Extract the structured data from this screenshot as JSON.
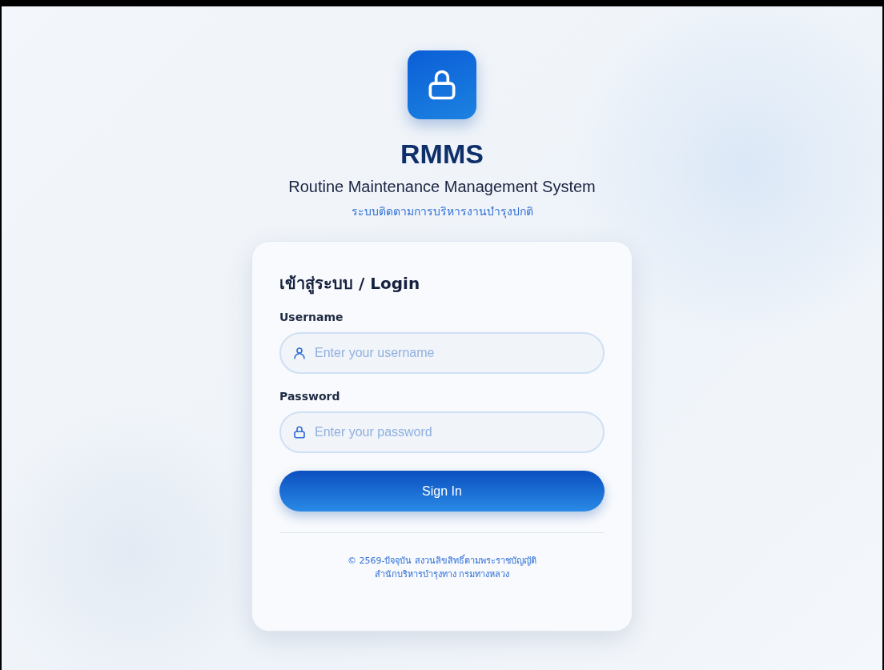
{
  "app": {
    "name": "RMMS",
    "full_name": "Routine Maintenance Management System",
    "thai_name": "ระบบติดตามการบริหารงานบำรุงปกติ"
  },
  "login": {
    "title": "เข้าสู่ระบบ / Login",
    "fields": [
      {
        "kind": "user",
        "label": "Username",
        "placeholder": "Enter your username"
      },
      {
        "kind": "lock",
        "label": "Password",
        "placeholder": "Enter your password"
      }
    ],
    "button": "Sign In",
    "footer": [
      "© 2569-ปัจจุบัน สงวนลิขสิทธิ์ตามพระราชบัญญัติ",
      "สำนักบริหารบำรุงทาง กรมทางหลวง"
    ]
  }
}
